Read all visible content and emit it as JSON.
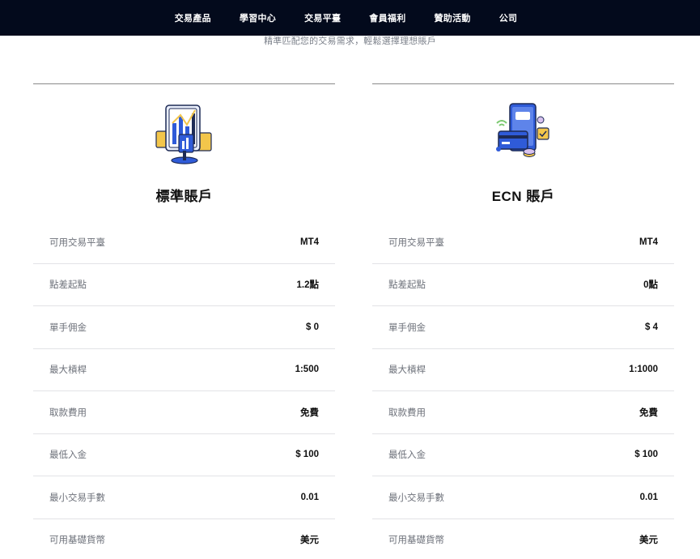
{
  "nav": {
    "items": [
      {
        "label": "交易產品"
      },
      {
        "label": "學習中心"
      },
      {
        "label": "交易平臺"
      },
      {
        "label": "會員福利"
      },
      {
        "label": "贊助活動"
      },
      {
        "label": "公司"
      }
    ]
  },
  "subtitle": "精準匹配您的交易需求，輕鬆選擇理想賬戶",
  "accounts": [
    {
      "title": "標準賬戶",
      "rows": [
        {
          "label": "可用交易平臺",
          "value": "MT4"
        },
        {
          "label": "點差起點",
          "value": "1.2點"
        },
        {
          "label": "單手佣金",
          "value": "$ 0"
        },
        {
          "label": "最大槓桿",
          "value": "1:500"
        },
        {
          "label": "取款費用",
          "value": "免費"
        },
        {
          "label": "最低入金",
          "value": "$ 100"
        },
        {
          "label": "最小交易手數",
          "value": "0.01"
        },
        {
          "label": "可用基礎貨幣",
          "value": "美元"
        }
      ]
    },
    {
      "title": "ECN 賬戶",
      "rows": [
        {
          "label": "可用交易平臺",
          "value": "MT4"
        },
        {
          "label": "點差起點",
          "value": "0點"
        },
        {
          "label": "單手佣金",
          "value": "$ 4"
        },
        {
          "label": "最大槓桿",
          "value": "1:1000"
        },
        {
          "label": "取款費用",
          "value": "免費"
        },
        {
          "label": "最低入金",
          "value": "$ 100"
        },
        {
          "label": "最小交易手數",
          "value": "0.01"
        },
        {
          "label": "可用基礎貨幣",
          "value": "美元"
        }
      ]
    }
  ],
  "colors": {
    "nav_bg": "#030a1c",
    "accent_blue": "#2f5bd8",
    "accent_yellow": "#f3c64b"
  },
  "icons": [
    "chart-document-illustration",
    "phone-card-illustration"
  ]
}
